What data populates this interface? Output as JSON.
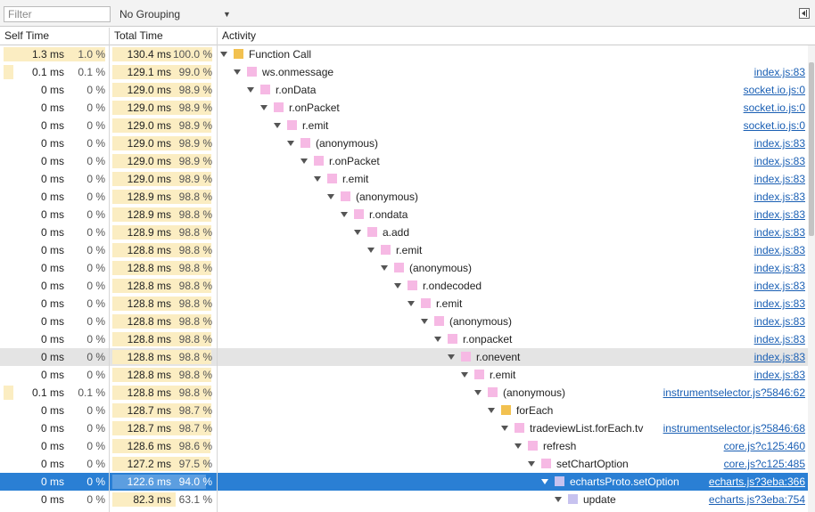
{
  "toolbar": {
    "filter_placeholder": "Filter",
    "grouping": "No Grouping"
  },
  "columns": {
    "self": "Self Time",
    "total": "Total Time",
    "activity": "Activity"
  },
  "colors": {
    "pink": "#f6b9e4",
    "yellow": "#f2c150",
    "lavender": "#c7c2ef",
    "selected": "#2a7fd4"
  },
  "rows": [
    {
      "self_ms": "1.3 ms",
      "self_pct": "1.0 %",
      "total_ms": "130.4 ms",
      "total_pct": "100.0 %",
      "self_frac": 1.0,
      "total_frac": 1.0,
      "depth": 0,
      "expander": true,
      "color": "yellow",
      "name": "Function Call",
      "link": ""
    },
    {
      "self_ms": "0.1 ms",
      "self_pct": "0.1 %",
      "total_ms": "129.1 ms",
      "total_pct": "99.0 %",
      "self_frac": 0.1,
      "total_frac": 0.99,
      "depth": 1,
      "expander": true,
      "color": "pink",
      "name": "ws.onmessage",
      "link": "index.js:83"
    },
    {
      "self_ms": "0 ms",
      "self_pct": "0 %",
      "total_ms": "129.0 ms",
      "total_pct": "98.9 %",
      "self_frac": 0,
      "total_frac": 0.989,
      "depth": 2,
      "expander": true,
      "color": "pink",
      "name": "r.onData",
      "link": "socket.io.js:0"
    },
    {
      "self_ms": "0 ms",
      "self_pct": "0 %",
      "total_ms": "129.0 ms",
      "total_pct": "98.9 %",
      "self_frac": 0,
      "total_frac": 0.989,
      "depth": 3,
      "expander": true,
      "color": "pink",
      "name": "r.onPacket",
      "link": "socket.io.js:0"
    },
    {
      "self_ms": "0 ms",
      "self_pct": "0 %",
      "total_ms": "129.0 ms",
      "total_pct": "98.9 %",
      "self_frac": 0,
      "total_frac": 0.989,
      "depth": 4,
      "expander": true,
      "color": "pink",
      "name": "r.emit",
      "link": "socket.io.js:0"
    },
    {
      "self_ms": "0 ms",
      "self_pct": "0 %",
      "total_ms": "129.0 ms",
      "total_pct": "98.9 %",
      "self_frac": 0,
      "total_frac": 0.989,
      "depth": 5,
      "expander": true,
      "color": "pink",
      "name": "(anonymous)",
      "link": "index.js:83"
    },
    {
      "self_ms": "0 ms",
      "self_pct": "0 %",
      "total_ms": "129.0 ms",
      "total_pct": "98.9 %",
      "self_frac": 0,
      "total_frac": 0.989,
      "depth": 6,
      "expander": true,
      "color": "pink",
      "name": "r.onPacket",
      "link": "index.js:83"
    },
    {
      "self_ms": "0 ms",
      "self_pct": "0 %",
      "total_ms": "129.0 ms",
      "total_pct": "98.9 %",
      "self_frac": 0,
      "total_frac": 0.989,
      "depth": 7,
      "expander": true,
      "color": "pink",
      "name": "r.emit",
      "link": "index.js:83"
    },
    {
      "self_ms": "0 ms",
      "self_pct": "0 %",
      "total_ms": "128.9 ms",
      "total_pct": "98.8 %",
      "self_frac": 0,
      "total_frac": 0.988,
      "depth": 8,
      "expander": true,
      "color": "pink",
      "name": "(anonymous)",
      "link": "index.js:83"
    },
    {
      "self_ms": "0 ms",
      "self_pct": "0 %",
      "total_ms": "128.9 ms",
      "total_pct": "98.8 %",
      "self_frac": 0,
      "total_frac": 0.988,
      "depth": 9,
      "expander": true,
      "color": "pink",
      "name": "r.ondata",
      "link": "index.js:83"
    },
    {
      "self_ms": "0 ms",
      "self_pct": "0 %",
      "total_ms": "128.9 ms",
      "total_pct": "98.8 %",
      "self_frac": 0,
      "total_frac": 0.988,
      "depth": 10,
      "expander": true,
      "color": "pink",
      "name": "a.add",
      "link": "index.js:83"
    },
    {
      "self_ms": "0 ms",
      "self_pct": "0 %",
      "total_ms": "128.8 ms",
      "total_pct": "98.8 %",
      "self_frac": 0,
      "total_frac": 0.988,
      "depth": 11,
      "expander": true,
      "color": "pink",
      "name": "r.emit",
      "link": "index.js:83"
    },
    {
      "self_ms": "0 ms",
      "self_pct": "0 %",
      "total_ms": "128.8 ms",
      "total_pct": "98.8 %",
      "self_frac": 0,
      "total_frac": 0.988,
      "depth": 12,
      "expander": true,
      "color": "pink",
      "name": "(anonymous)",
      "link": "index.js:83"
    },
    {
      "self_ms": "0 ms",
      "self_pct": "0 %",
      "total_ms": "128.8 ms",
      "total_pct": "98.8 %",
      "self_frac": 0,
      "total_frac": 0.988,
      "depth": 13,
      "expander": true,
      "color": "pink",
      "name": "r.ondecoded",
      "link": "index.js:83"
    },
    {
      "self_ms": "0 ms",
      "self_pct": "0 %",
      "total_ms": "128.8 ms",
      "total_pct": "98.8 %",
      "self_frac": 0,
      "total_frac": 0.988,
      "depth": 14,
      "expander": true,
      "color": "pink",
      "name": "r.emit",
      "link": "index.js:83"
    },
    {
      "self_ms": "0 ms",
      "self_pct": "0 %",
      "total_ms": "128.8 ms",
      "total_pct": "98.8 %",
      "self_frac": 0,
      "total_frac": 0.988,
      "depth": 15,
      "expander": true,
      "color": "pink",
      "name": "(anonymous)",
      "link": "index.js:83"
    },
    {
      "self_ms": "0 ms",
      "self_pct": "0 %",
      "total_ms": "128.8 ms",
      "total_pct": "98.8 %",
      "self_frac": 0,
      "total_frac": 0.988,
      "depth": 16,
      "expander": true,
      "color": "pink",
      "name": "r.onpacket",
      "link": "index.js:83"
    },
    {
      "self_ms": "0 ms",
      "self_pct": "0 %",
      "total_ms": "128.8 ms",
      "total_pct": "98.8 %",
      "self_frac": 0,
      "total_frac": 0.988,
      "depth": 17,
      "expander": true,
      "color": "pink",
      "name": "r.onevent",
      "link": "index.js:83",
      "state": "hover"
    },
    {
      "self_ms": "0 ms",
      "self_pct": "0 %",
      "total_ms": "128.8 ms",
      "total_pct": "98.8 %",
      "self_frac": 0,
      "total_frac": 0.988,
      "depth": 18,
      "expander": true,
      "color": "pink",
      "name": "r.emit",
      "link": "index.js:83"
    },
    {
      "self_ms": "0.1 ms",
      "self_pct": "0.1 %",
      "total_ms": "128.8 ms",
      "total_pct": "98.8 %",
      "self_frac": 0.1,
      "total_frac": 0.988,
      "depth": 19,
      "expander": true,
      "color": "pink",
      "name": "(anonymous)",
      "link": "instrumentselector.js?5846:62"
    },
    {
      "self_ms": "0 ms",
      "self_pct": "0 %",
      "total_ms": "128.7 ms",
      "total_pct": "98.7 %",
      "self_frac": 0,
      "total_frac": 0.987,
      "depth": 20,
      "expander": true,
      "color": "yellow",
      "name": "forEach",
      "link": ""
    },
    {
      "self_ms": "0 ms",
      "self_pct": "0 %",
      "total_ms": "128.7 ms",
      "total_pct": "98.7 %",
      "self_frac": 0,
      "total_frac": 0.987,
      "depth": 21,
      "expander": true,
      "color": "pink",
      "name": "tradeviewList.forEach.tv",
      "link": "instrumentselector.js?5846:68"
    },
    {
      "self_ms": "0 ms",
      "self_pct": "0 %",
      "total_ms": "128.6 ms",
      "total_pct": "98.6 %",
      "self_frac": 0,
      "total_frac": 0.986,
      "depth": 22,
      "expander": true,
      "color": "pink",
      "name": "refresh",
      "link": "core.js?c125:460"
    },
    {
      "self_ms": "0 ms",
      "self_pct": "0 %",
      "total_ms": "127.2 ms",
      "total_pct": "97.5 %",
      "self_frac": 0,
      "total_frac": 0.975,
      "depth": 23,
      "expander": true,
      "color": "pink",
      "name": "setChartOption",
      "link": "core.js?c125:485"
    },
    {
      "self_ms": "0 ms",
      "self_pct": "0 %",
      "total_ms": "122.6 ms",
      "total_pct": "94.0 %",
      "self_frac": 0,
      "total_frac": 0.94,
      "depth": 24,
      "expander": true,
      "color": "lavender",
      "name": "echartsProto.setOption",
      "link": "echarts.js?3eba:366",
      "state": "selected"
    },
    {
      "self_ms": "0 ms",
      "self_pct": "0 %",
      "total_ms": "82.3 ms",
      "total_pct": "63.1 %",
      "self_frac": 0,
      "total_frac": 0.631,
      "depth": 25,
      "expander": true,
      "color": "lavender",
      "name": "update",
      "link": "echarts.js?3eba:754"
    }
  ]
}
